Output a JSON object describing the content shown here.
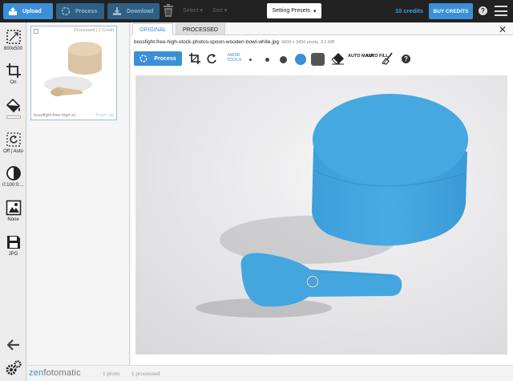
{
  "topbar": {
    "upload_label": "Upload",
    "process_label": "Process",
    "download_label": "Download",
    "select_label": "Select",
    "sort_label": "Sort",
    "presets_label": "Setting Presets",
    "credits_label": "10 credits",
    "buy_label": "BUY CREDITS",
    "help_label": "?"
  },
  "leftbar": {
    "tools": [
      {
        "name": "resize",
        "label": "600x500"
      },
      {
        "name": "crop",
        "label": "On"
      },
      {
        "name": "background-fill",
        "label": ""
      },
      {
        "name": "auto-rotate",
        "label": "Off | Auto"
      },
      {
        "name": "contrast",
        "label": "0:100:0:..."
      },
      {
        "name": "shadow",
        "label": "None"
      },
      {
        "name": "format",
        "label": "JPG"
      }
    ]
  },
  "thumbnail": {
    "status": "Processed",
    "credits": "1 Credit",
    "filename": "bossfight-free-high-st...",
    "touchup": "Touch Up"
  },
  "main": {
    "tab_original": "ORIGINAL",
    "tab_processed": "PROCESSED",
    "close": "✕",
    "filename": "bossfight-free-high-stock-photos-spoon-wooden-bowl-white.jpg",
    "fileinfo": "4608 x 3456 pixels, 3.1 MB",
    "process_label": "Process",
    "mask_tools": "MASK TOOLS",
    "auto_mask": "AUTO MASK",
    "auto_fill": "AUTO FILL",
    "help_label": "?"
  },
  "bottom": {
    "logo_a": "zen",
    "logo_b": "fotomatic",
    "photos": "1 photo",
    "processed": "1 processed"
  },
  "colors": {
    "accent": "#3a8fd8",
    "mask_blue": "#3aa0e0",
    "topbar": "#222222"
  }
}
